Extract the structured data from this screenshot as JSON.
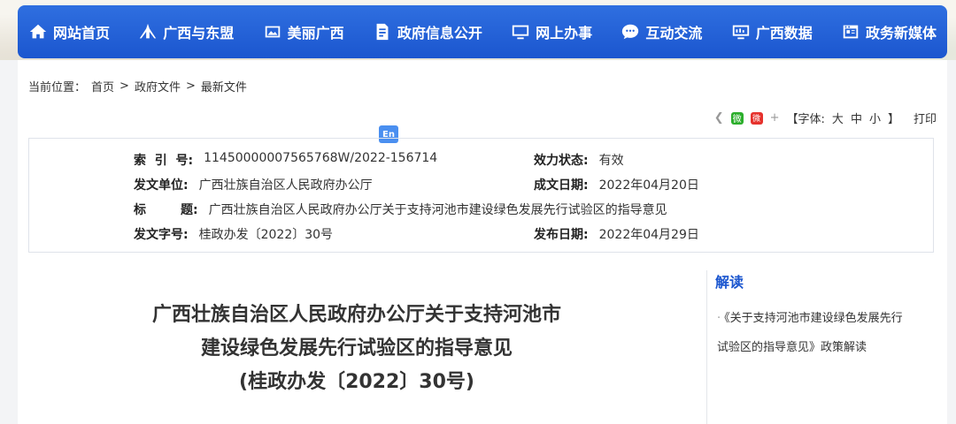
{
  "nav": {
    "items": [
      {
        "label": "网站首页",
        "icon": "home-icon"
      },
      {
        "label": "广西与东盟",
        "icon": "bridge-icon"
      },
      {
        "label": "美丽广西",
        "icon": "landscape-icon"
      },
      {
        "label": "政府信息公开",
        "icon": "document-icon"
      },
      {
        "label": "网上办事",
        "icon": "monitor-icon"
      },
      {
        "label": "互动交流",
        "icon": "chat-icon"
      },
      {
        "label": "广西数据",
        "icon": "chart-icon"
      },
      {
        "label": "政务新媒体",
        "icon": "media-icon"
      }
    ]
  },
  "breadcrumb": {
    "prefix": "当前位置：",
    "items": [
      "首页",
      "政府文件",
      "最新文件"
    ],
    "sep": ">"
  },
  "tools": {
    "font_label": "【字体:",
    "sizes": [
      "大",
      "中",
      "小"
    ],
    "font_close": "】",
    "plus": "+",
    "print": "打印",
    "wechat": "微",
    "weibo": "微"
  },
  "en_badge": "En",
  "meta": {
    "index_label": "索  引  号:",
    "index_value": "11450000007565768W/2022-156714",
    "status_label": "效力状态:",
    "status_value": "有效",
    "issuer_label": "发文单位:",
    "issuer_value": "广西壮族自治区人民政府办公厅",
    "created_label": "成文日期:",
    "created_value": "2022年04月20日",
    "title_label": "标        题:",
    "title_value": "广西壮族自治区人民政府办公厅关于支持河池市建设绿色发展先行试验区的指导意见",
    "docno_label": "发文字号:",
    "docno_value": "桂政办发〔2022〕30号",
    "published_label": "发布日期:",
    "published_value": "2022年04月29日"
  },
  "doc": {
    "title_line1": "广西壮族自治区人民政府办公厅关于支持河池市",
    "title_line2": "建设绿色发展先行试验区的指导意见",
    "title_line3": "(桂政办发〔2022〕30号)"
  },
  "sidebar": {
    "title": "解读",
    "item": "《关于支持河池市建设绿色发展先行试验区的指导意见》政策解读"
  }
}
